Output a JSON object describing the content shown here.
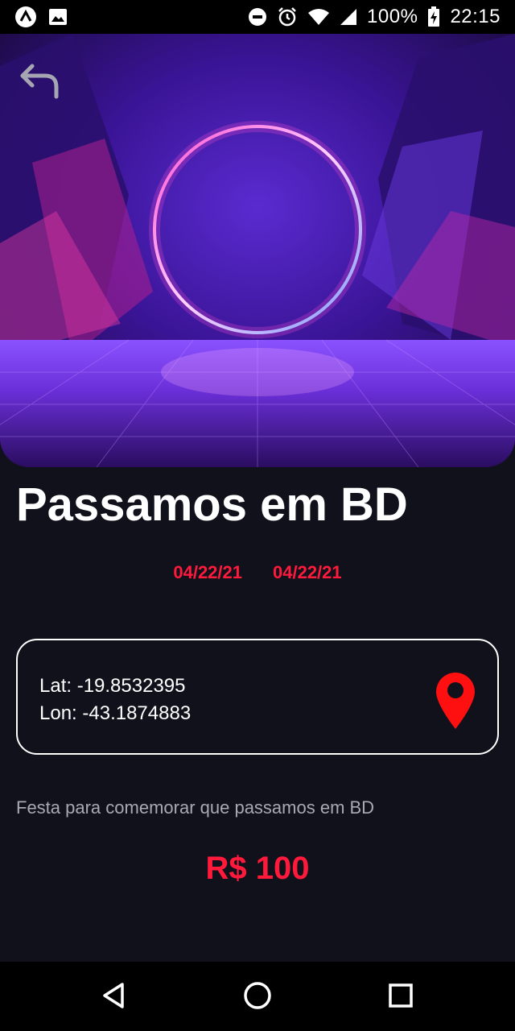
{
  "status_bar": {
    "battery": "100%",
    "time": "22:15",
    "icons": [
      "app-notification-icon",
      "image-notification-icon",
      "dnd-icon",
      "alarm-icon",
      "wifi-icon",
      "signal-icon",
      "battery-charging-icon"
    ]
  },
  "event": {
    "title": "Passamos em BD",
    "start_date": "04/22/21",
    "end_date": "04/22/21",
    "location": {
      "lat_text": "Lat: -19.8532395",
      "lon_text": "Lon: -43.1874883"
    },
    "description": "Festa para comemorar que passamos em BD",
    "price": "R$ 100"
  },
  "icons": {
    "back": "back-arrow-icon",
    "pin": "map-pin-icon",
    "nav": [
      "back-triangle-icon",
      "home-circle-icon",
      "recents-square-icon"
    ]
  },
  "colors": {
    "background": "#11111c",
    "accent": "#ff1a3c",
    "pin": "#ff1010",
    "muted_text": "#a9a9b1"
  }
}
